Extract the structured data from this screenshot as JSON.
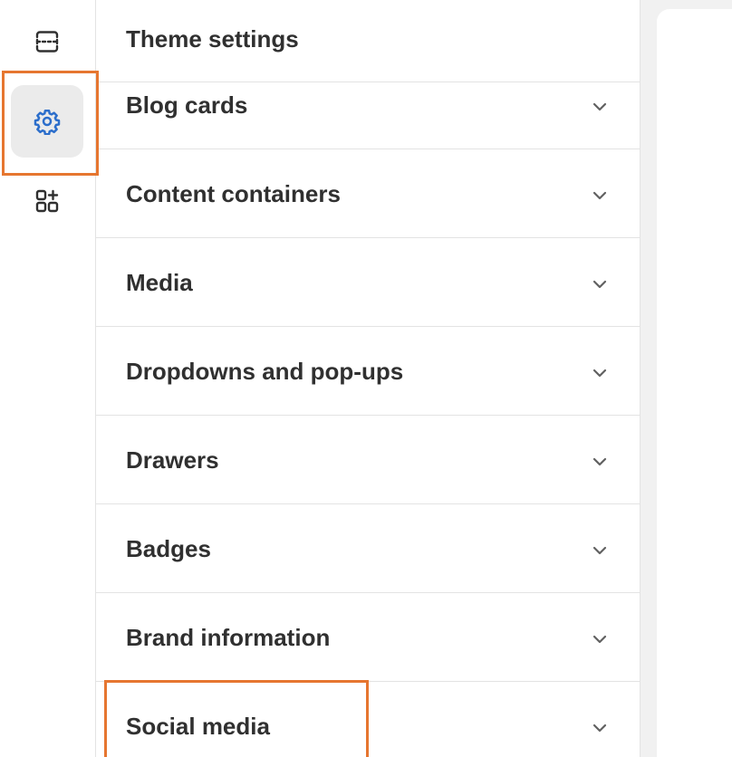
{
  "rail": {
    "items": [
      {
        "icon": "sections-icon"
      },
      {
        "icon": "gear-icon",
        "active": true
      },
      {
        "icon": "add-app-icon"
      }
    ]
  },
  "panel": {
    "title": "Theme settings",
    "rows": [
      {
        "label": "Blog cards"
      },
      {
        "label": "Content containers"
      },
      {
        "label": "Media"
      },
      {
        "label": "Dropdowns and pop-ups"
      },
      {
        "label": "Drawers"
      },
      {
        "label": "Badges"
      },
      {
        "label": "Brand information"
      },
      {
        "label": "Social media"
      }
    ]
  },
  "colors": {
    "accent": "#2c6ecb",
    "highlight": "#e67630",
    "text": "#303030"
  }
}
